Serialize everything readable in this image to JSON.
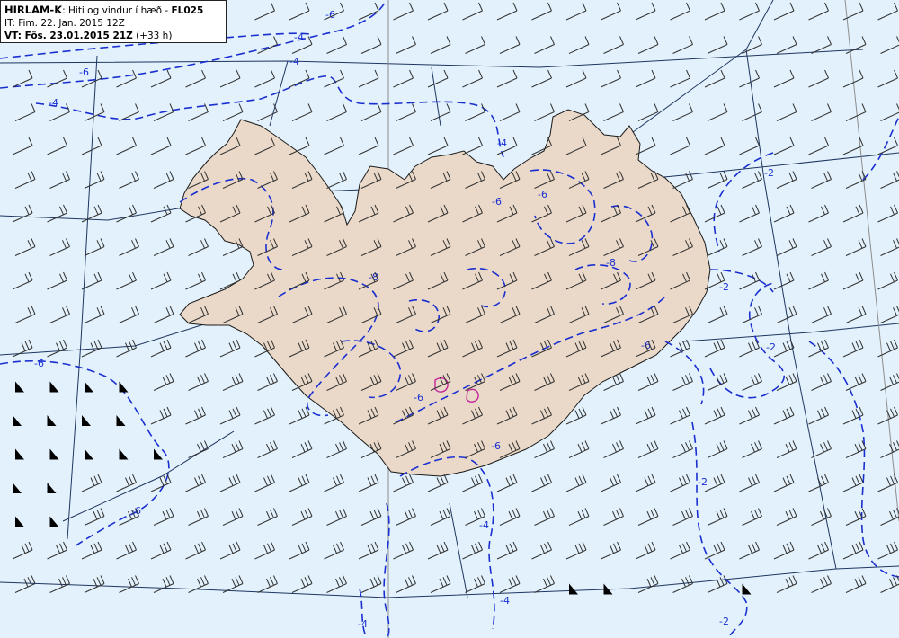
{
  "header": {
    "model": "HIRLAM-K",
    "title_rest": ": Hiti og vindur í hæð - ",
    "level": "FL025",
    "it_text": "IT: Fim. 22. Jan. 2015 12Z",
    "vt_prefix": "VT: ",
    "vt_bold": "Fös. 23.01.2015 21Z",
    "vt_lead": " (+33 h)"
  },
  "contour_labels": [
    "-6",
    "-4",
    "-6",
    "-4",
    "-4",
    "-6",
    "-6",
    "-8",
    "-6",
    "-6",
    "-8",
    "-4",
    "-6",
    "-6",
    "-4",
    "-6",
    "-2",
    "-2",
    "-2",
    "-4",
    "-2",
    "-4",
    "-2"
  ],
  "colors": {
    "sea": "#e2f1fb",
    "land": "#ead9c8",
    "land_outline": "#1a1a1a",
    "isotherm": "#1a2fd0",
    "warm_isotherm": "#c4269a",
    "grid": "#1f3560",
    "wind_barb": "#333333"
  },
  "icons": {
    "wind_barb": "wind-barb-icon",
    "pennant": "wind-pennant-icon"
  }
}
